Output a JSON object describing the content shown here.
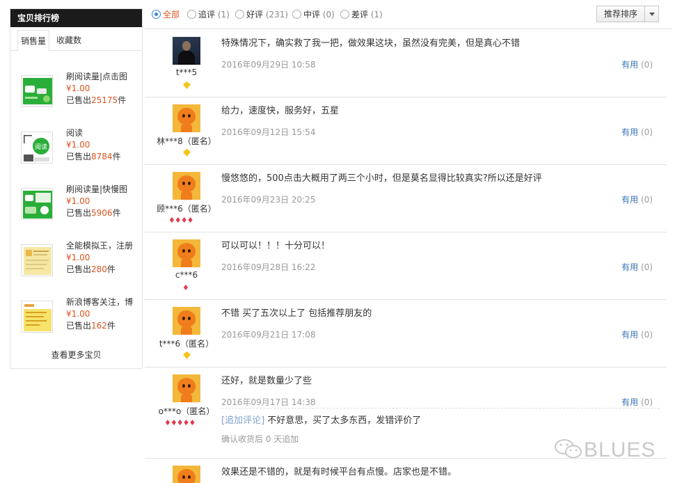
{
  "sidebar": {
    "title": "宝贝排行榜",
    "tabs": [
      "销售量",
      "收藏数"
    ],
    "items": [
      {
        "name": "刷阅读量|点击图",
        "price": "¥1.00",
        "sold_prefix": "已售出",
        "sold_num": "25175",
        "sold_suffix": "件"
      },
      {
        "name": "阅读",
        "price": "¥1.00",
        "sold_prefix": "已售出",
        "sold_num": "8784",
        "sold_suffix": "件"
      },
      {
        "name": "刷阅读量|快慢图",
        "price": "¥1.00",
        "sold_prefix": "已售出",
        "sold_num": "5906",
        "sold_suffix": "件"
      },
      {
        "name": "全能模拟王，注册",
        "price": "¥1.00",
        "sold_prefix": "已售出",
        "sold_num": "280",
        "sold_suffix": "件"
      },
      {
        "name": "新浪博客关注，博",
        "price": "¥1.00",
        "sold_prefix": "已售出",
        "sold_num": "162",
        "sold_suffix": "件"
      }
    ],
    "more": "查看更多宝贝"
  },
  "filters": {
    "options": [
      {
        "label": "全部",
        "count": ""
      },
      {
        "label": "追评",
        "count": "(1)"
      },
      {
        "label": "好评",
        "count": "(231)"
      },
      {
        "label": "中评",
        "count": "(0)"
      },
      {
        "label": "差评",
        "count": "(1)"
      }
    ],
    "sort_label": "推荐排序"
  },
  "reviews": [
    {
      "user": "t***5",
      "content": "特殊情况下，确实救了我一把，做效果这块，虽然没有完美，但是真心不错",
      "date": "2016年09月29日 10:58",
      "useful": "有用",
      "useful_count": "(0)"
    },
    {
      "user": "林***8（匿名）",
      "content": "给力，速度快，服务好，五星",
      "date": "2016年09月12日 15:54",
      "useful": "有用",
      "useful_count": "(0)"
    },
    {
      "user": "顾***6（匿名）",
      "content": "慢悠悠的，500点击大概用了两三个小时，但是莫名显得比较真实?所以还是好评",
      "date": "2016年09月23日 20:25",
      "useful": "有用",
      "useful_count": "(0)"
    },
    {
      "user": "c***6",
      "content": "可以可以！！！十分可以！",
      "date": "2016年09月28日 16:22",
      "useful": "有用",
      "useful_count": "(0)"
    },
    {
      "user": "t***6（匿名）",
      "content": "不错 买了五次以上了 包括推荐朋友的",
      "date": "2016年09月21日 17:08",
      "useful": "有用",
      "useful_count": "(0)"
    },
    {
      "user": "o***o（匿名）",
      "content": "还好，就是数量少了些",
      "date": "2016年09月17日 14:38",
      "useful": "有用",
      "useful_count": "(0)",
      "followup_tag": "[追加评论]",
      "followup_text": "不好意思，买了太多东西，发错评价了",
      "followup_meta": "确认收货后 0 天追加"
    },
    {
      "user": "",
      "content": "效果还是不错的，就是有时候平台有点慢。店家也是不错。",
      "date": "",
      "useful": "",
      "useful_count": ""
    }
  ],
  "watermark": "BLUES",
  "colors": {
    "accent": "#d9531e",
    "link": "#3a73b8",
    "radio": "#3a87d8",
    "header_bg": "#1b1b1b"
  }
}
